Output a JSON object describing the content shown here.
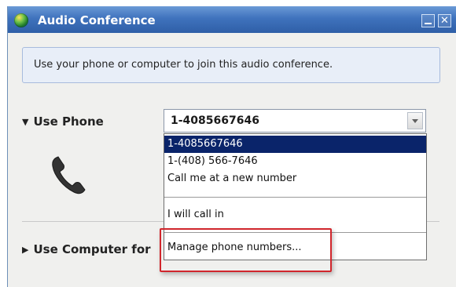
{
  "window": {
    "title": "Audio Conference",
    "icon": "globe-icon",
    "minimize_icon": "minimize-icon",
    "close_icon": "close-icon",
    "close_glyph": "✕"
  },
  "info": {
    "text": "Use your phone or computer to join this audio conference."
  },
  "use_phone": {
    "label": "Use Phone",
    "icon": "telephone-handset-icon",
    "selected_value": "1-4085667646",
    "options": [
      "1-4085667646",
      "1-(408) 566-7646",
      "Call me at a new number",
      "I will call in",
      "Manage phone numbers..."
    ]
  },
  "use_computer": {
    "label": "Use Computer for"
  },
  "colors": {
    "title_bar": "#3f72bd",
    "selection": "#0a246a",
    "highlight": "#d1262c"
  }
}
